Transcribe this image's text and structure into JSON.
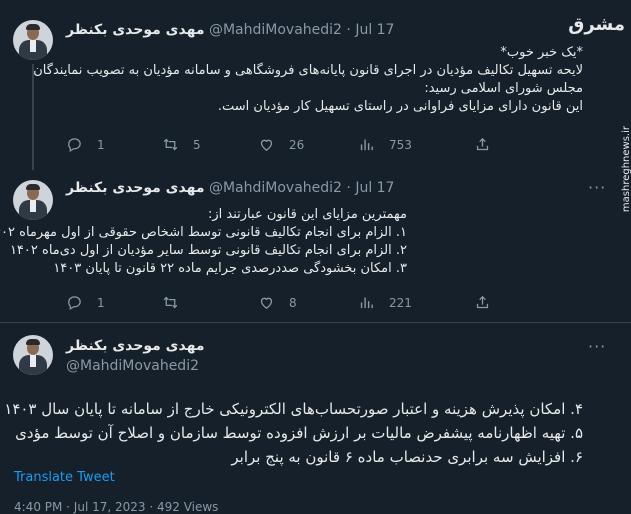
{
  "brand": {
    "logo": "مشرق",
    "url": "mashreghnews.ir"
  },
  "tweets": [
    {
      "name": "مهدی موحدی بکنظر",
      "handle": "@MahdiMovahedi2",
      "date": "Jul 17",
      "lines": [
        "*یک خبر خوب*",
        "لایحه تسهیل تکالیف مؤدیان در اجرای قانون پایانه‌های فروشگاهی و سامانه مؤدیان به تصویب نمایندگان",
        "مجلس شورای اسلامی رسید:",
        "این قانون دارای مزایای فراوانی در راستای تسهیل کار مؤدیان است."
      ],
      "replies": "1",
      "retweets": "5",
      "likes": "26",
      "views": "753"
    },
    {
      "name": "مهدی موحدی بکنظر",
      "handle": "@MahdiMovahedi2",
      "date": "Jul 17",
      "lines": [
        "مهمترین مزایای این قانون عبارتند از:",
        "۱. الزام برای انجام تکالیف قانونی توسط اشخاص حقوقی از اول مهرماه ۱۴۰۲",
        "۲. الزام برای انجام تکالیف قانونی توسط سایر مؤدیان از اول دی‌ماه ۱۴۰۲",
        "۳. امکان بخشودگی صددرصدی جرایم ماده ۲۲ قانون تا پایان ۱۴۰۳"
      ],
      "replies": "1",
      "retweets": "",
      "likes": "8",
      "views": "221"
    },
    {
      "name": "مهدی موحدی بکنظر",
      "handle": "@MahdiMovahedi2",
      "lines": [
        "۴. امکان پذیرش هزینه و اعتبار صورتحساب‌های الکترونیکی خارج از سامانه تا پایان سال ۱۴۰۳",
        "۵. تهیه اظهارنامه پیشفرض مالیات بر ارزش افزوده توسط سازمان و اصلاح آن توسط مؤدی",
        "۶. افزایش سه برابری حدنصاب ماده ۶ قانون به پنج برابر"
      ],
      "translate": "Translate Tweet",
      "footer": "4:40 PM · Jul 17, 2023 · 492 Views"
    }
  ]
}
